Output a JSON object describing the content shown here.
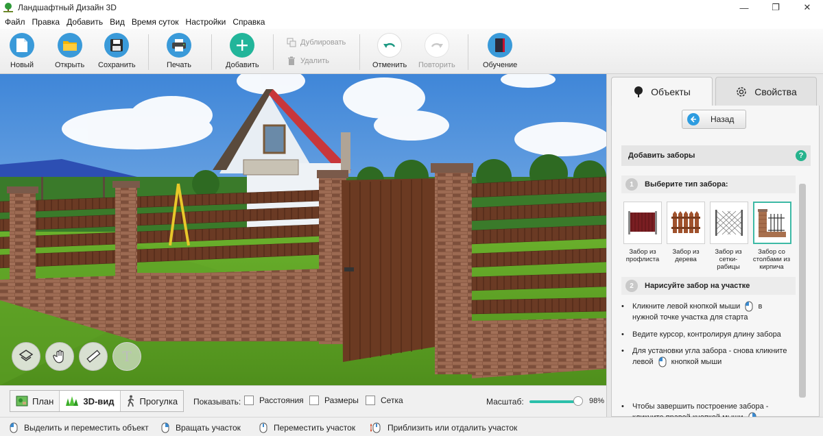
{
  "window": {
    "title": "Ландшафтный Дизайн 3D",
    "controls": [
      "—",
      "❐",
      "✕"
    ]
  },
  "menu": [
    "Файл",
    "Правка",
    "Добавить",
    "Вид",
    "Время суток",
    "Настройки",
    "Справка"
  ],
  "toolbar": {
    "new": "Новый",
    "open": "Открыть",
    "save": "Сохранить",
    "print": "Печать",
    "add": "Добавить",
    "duplicate": "Дублировать",
    "delete": "Удалить",
    "undo": "Отменить",
    "redo": "Повторить",
    "learn": "Обучение"
  },
  "viewport_tools": [
    "layers-icon",
    "hand-icon",
    "ruler-icon",
    "text-icon"
  ],
  "view_tabs": {
    "plan": "План",
    "view3d": "3D-вид",
    "walk": "Прогулка"
  },
  "show": {
    "label": "Показывать:",
    "distances": "Расстояния",
    "sizes": "Размеры",
    "grid": "Сетка"
  },
  "zoom": {
    "label": "Масштаб:",
    "value": "98%",
    "level": 0.98
  },
  "panel": {
    "tab_objects": "Объекты",
    "tab_properties": "Свойства",
    "back": "Назад",
    "section_title": "Добавить заборы",
    "help": "?",
    "step1_num": "1",
    "step1": "Выберите тип забора:",
    "fences": [
      {
        "caption": "Забор из профлиста"
      },
      {
        "caption": "Забор из дерева"
      },
      {
        "caption": "Забор из сетки-рабицы"
      },
      {
        "caption": "Забор со столбами из кирпича"
      }
    ],
    "step2_num": "2",
    "step2": "Нарисуйте забор на участке",
    "bullet1_a": "Кликните левой кнопкой мыши",
    "bullet1_b": "в нужной точке участка для старта",
    "bullet2": "Ведите курсор, контролируя длину забора",
    "bullet3_a": "Для установки угла забора - снова кликните",
    "bullet3_b": "левой",
    "bullet3_c": "кнопкой мыши",
    "bullet4_a": "Чтобы завершить построение забора -",
    "bullet4_b": "кликните правой кнопкой мыши"
  },
  "status": {
    "select": "Выделить и переместить объект",
    "rotate": "Вращать участок",
    "move": "Переместить участок",
    "zoom": "Приблизить или отдалить участок"
  }
}
